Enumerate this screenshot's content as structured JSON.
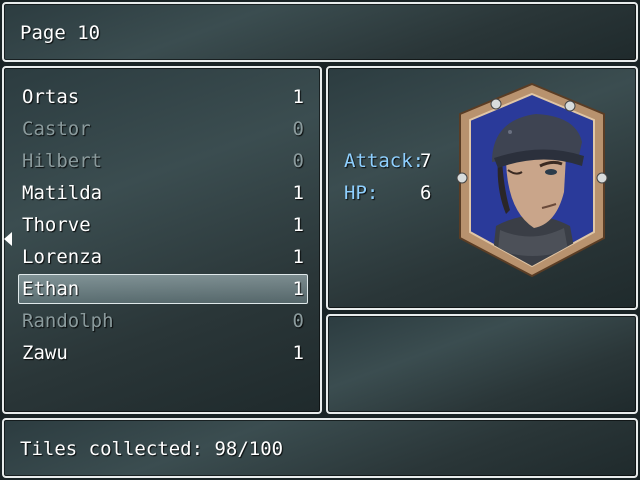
{
  "header": {
    "title": "Page 10"
  },
  "characters": [
    {
      "name": "Ortas",
      "count": "1",
      "state": "normal"
    },
    {
      "name": "Castor",
      "count": "0",
      "state": "disabled"
    },
    {
      "name": "Hilbert",
      "count": "0",
      "state": "disabled"
    },
    {
      "name": "Matilda",
      "count": "1",
      "state": "normal"
    },
    {
      "name": "Thorve",
      "count": "1",
      "state": "normal"
    },
    {
      "name": "Lorenza",
      "count": "1",
      "state": "normal"
    },
    {
      "name": "Ethan",
      "count": "1",
      "state": "selected"
    },
    {
      "name": "Randolph",
      "count": "0",
      "state": "disabled"
    },
    {
      "name": "Zawu",
      "count": "1",
      "state": "normal"
    }
  ],
  "detail": {
    "attack_label": "Attack:",
    "attack_value": "7",
    "hp_label": "HP:",
    "hp_value": "6",
    "portrait_icon": "character-portrait"
  },
  "footer": {
    "status": "Tiles collected: 98/100"
  },
  "colors": {
    "window_border": "#e8ecec",
    "label_blue": "#8fd0ff",
    "disabled_text": "#8a9a9c",
    "portrait_frame": "#b8926e",
    "portrait_bg": "#2a3a9a"
  }
}
